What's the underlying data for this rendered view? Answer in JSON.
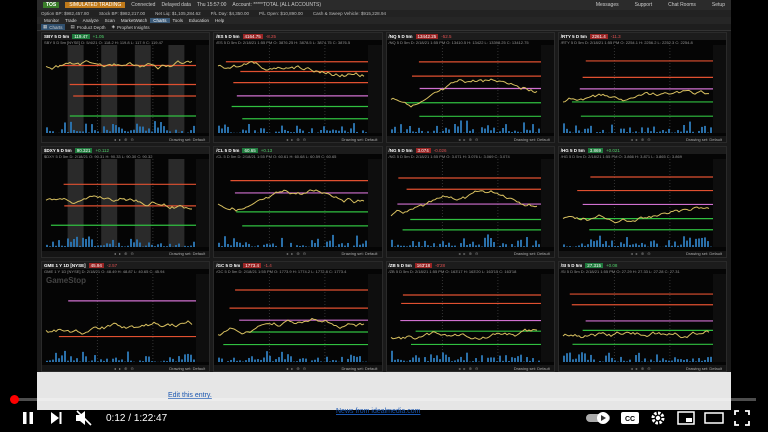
{
  "platform": {
    "badge": "TOS",
    "mode": "SIMULATED TRADING",
    "status": "Connected",
    "delayed": "Delayed data",
    "date": "Thu 15:57:00",
    "account": "Account: *****TOTAL (ALL ACCOUNTS)",
    "links": [
      "Messages",
      "Support",
      "Chat Rooms",
      "Setup"
    ],
    "acct_values": [
      "Option BP: $982,457.80",
      "Stock BP: $982,217.00",
      "Net Liq: $1,105,284.62",
      "P/L Day: $4,350.00",
      "P/L Open: $10,890.00",
      "Cash & Sweep Vehicle: $915,228.94"
    ],
    "menu": [
      "Monitor",
      "Trade",
      "Analyze",
      "Scan",
      "MarketWatch",
      "Charts",
      "Tools",
      "Education",
      "Help"
    ],
    "active_menu": "Charts",
    "toolbar": [
      "Charts",
      "Product Depth",
      "Prophet Insights"
    ]
  },
  "panels": [
    {
      "symbol": "SBY 5 D 5m",
      "price": "119.47",
      "change": "+1.05",
      "down": false,
      "sub": "SBY 5 D 5m [NYSE]  D: 5/4/21  O: 118.2  H: 119.8  L: 117.9  C: 119.47",
      "foot": "Drawing set: Default",
      "watermark": "",
      "seed": 1,
      "lines": [
        "#e05030",
        "#e05030",
        "#e05030",
        "#30c040"
      ],
      "shaded": true
    },
    {
      "symbol": "/ES 5 D 5m",
      "price": "4164.75",
      "change": "-8.25",
      "down": true,
      "sub": "/ES 5 D 5m  D: 2/18/21 1:55 PM  O: 3876.25  H: 3878.5  L: 3874.75  C: 3876.5",
      "foot": "Drawing set: Default",
      "watermark": "",
      "seed": 2,
      "lines": [
        "#e05030",
        "#e05030",
        "#e05030",
        "#d070d0",
        "#30c040",
        "#30c040"
      ],
      "shaded": false
    },
    {
      "symbol": "/NQ 5 D 5m",
      "price": "13442.25",
      "change": "-52.5",
      "down": true,
      "sub": "/NQ 5 D 5m  D: 2/18/21 1:55 PM  O: 13410.5  H: 13422  L: 13398.25  C: 13412.75",
      "foot": "Drawing set: Default",
      "watermark": "",
      "seed": 3,
      "lines": [
        "#e05030",
        "#e05030",
        "#d070d0",
        "#30c040",
        "#30c040"
      ],
      "shaded": false
    },
    {
      "symbol": "/RTY 5 D 5m",
      "price": "2261.4",
      "change": "-11.3",
      "down": true,
      "sub": "/RTY 5 D 5m  D: 2/18/21 1:55 PM  O: 2254.1  H: 2256.2  L: 2252.3  C: 2254.8",
      "foot": "Drawing set: Default",
      "watermark": "",
      "seed": 4,
      "lines": [
        "#e05030",
        "#e05030",
        "#d070d0",
        "#30c040",
        "#30c040"
      ],
      "shaded": false
    },
    {
      "symbol": "$DXY 5 D 5m",
      "price": "90.321",
      "change": "+0.112",
      "down": false,
      "sub": "$DXY 5 D 5m  D: 2/18/21  O: 90.31  H: 90.33  L: 90.30  C: 90.32",
      "foot": "Drawing set: Default",
      "watermark": "",
      "seed": 5,
      "lines": [
        "#e05030",
        "#e05030",
        "#30c040"
      ],
      "shaded": true
    },
    {
      "symbol": "/CL 5 D 5m",
      "price": "60.65",
      "change": "+0.13",
      "down": false,
      "sub": "/CL 5 D 5m  D: 2/18/21 1:55 PM  O: 60.61  H: 60.68  L: 60.59  C: 60.65",
      "foot": "Drawing set: Default",
      "watermark": "",
      "seed": 6,
      "lines": [
        "#e05030",
        "#d070d0",
        "#30c040",
        "#30c040"
      ],
      "shaded": false
    },
    {
      "symbol": "/NG 5 D 5m",
      "price": "3.074",
      "change": "-0.026",
      "down": true,
      "sub": "/NG 5 D 5m  D: 2/18/21 1:55 PM  O: 3.071  H: 3.076  L: 3.069  C: 3.074",
      "foot": "Drawing set: Default",
      "watermark": "",
      "seed": 7,
      "lines": [
        "#e05030",
        "#e05030",
        "#d070d0",
        "#30c040",
        "#30c040"
      ],
      "shaded": false
    },
    {
      "symbol": "/HG 5 D 5m",
      "price": "3.869",
      "change": "+0.021",
      "down": false,
      "sub": "/HG 5 D 5m  D: 2/18/21 1:55 PM  O: 3.866  H: 3.871  L: 3.865  C: 3.869",
      "foot": "Drawing set: Default",
      "watermark": "",
      "seed": 8,
      "lines": [
        "#e05030",
        "#e05030",
        "#d070d0",
        "#30c040",
        "#30c040"
      ],
      "shaded": false
    },
    {
      "symbol": "GME 1 Y 1D [NYSE]",
      "price": "45.94",
      "change": "-2.57",
      "down": true,
      "sub": "GME 1 Y 1D [NYSE]  D: 2/18/21  O: 48.49  H: 48.87  L: 40.65  C: 45.94",
      "foot": "Drawing set: Default",
      "watermark": "GameStop",
      "seed": 9,
      "lines": [
        "#d070d0",
        "#e05030"
      ],
      "shaded": false
    },
    {
      "symbol": "/GC 5 D 5m",
      "price": "1773.4",
      "change": "-1.4",
      "down": true,
      "sub": "/GC 5 D 5m  D: 2/18/21 1:55 PM  O: 1773.9  H: 1774.2  L: 1772.8  C: 1773.4",
      "foot": "Drawing set: Default",
      "watermark": "",
      "seed": 10,
      "lines": [
        "#e05030",
        "#e05030",
        "#d070d0",
        "#30c040",
        "#30c040"
      ],
      "shaded": false
    },
    {
      "symbol": "/ZB 5 D 5m",
      "price": "163'18",
      "change": "-0'28",
      "down": true,
      "sub": "/ZB 5 D 5m  D: 2/18/21 1:55 PM  O: 163'17  H: 163'20  L: 163'15  C: 163'18",
      "foot": "Drawing set: Default",
      "watermark": "",
      "seed": 11,
      "lines": [
        "#e05030",
        "#e05030",
        "#d070d0",
        "#30c040",
        "#30c040"
      ],
      "shaded": false
    },
    {
      "symbol": "/SI 5 D 5m",
      "price": "27.315",
      "change": "+0.08",
      "down": false,
      "sub": "/SI 5 D 5m  D: 2/18/21 1:55 PM  O: 27.29  H: 27.33  L: 27.28  C: 27.31",
      "foot": "Drawing set: Default",
      "watermark": "",
      "seed": 12,
      "lines": [
        "#e05030",
        "#e05030",
        "#d070d0",
        "#30c040",
        "#30c040"
      ],
      "shaded": false
    }
  ],
  "overlay": {
    "edit_link": "Edit this entry.",
    "news_link": "News from idealmedia.com"
  },
  "player": {
    "current": "0:12",
    "separator": " / ",
    "duration": "1:22:47",
    "progress": 0.0024
  }
}
